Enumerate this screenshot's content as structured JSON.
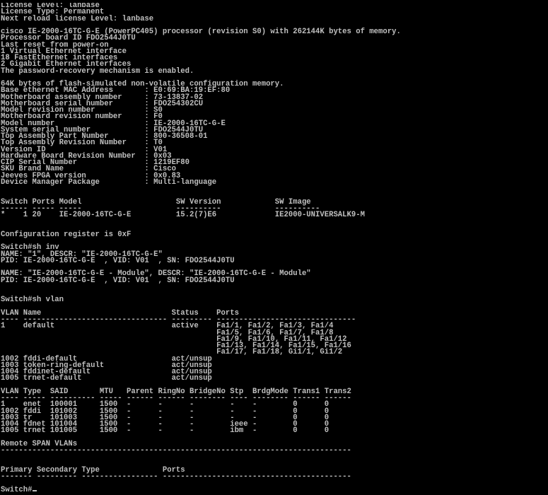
{
  "window": {
    "background_color": "#000000",
    "text_color": "#c0c0c0"
  },
  "terminal": {
    "lines": [
      "License Level: lanbase",
      "License Type: Permanent",
      "Next reload license Level: lanbase",
      "",
      "cisco IE-2000-16TC-G-E (PowerPC405) processor (revision S0) with 262144K bytes of memory.",
      "Processor board ID FDO2544J0TU",
      "Last reset from power-on",
      "1 Virtual Ethernet interface",
      "18 FastEthernet interfaces",
      "2 Gigabit Ethernet interfaces",
      "The password-recovery mechanism is enabled.",
      "",
      "64K bytes of flash-simulated non-volatile configuration memory.",
      "Base ethernet MAC Address       : E0:69:BA:19:EF:80",
      "Motherboard assembly number     : 73-13837-02",
      "Motherboard serial number       : FDO254302CU",
      "Model revision number           : S0",
      "Motherboard revision number     : F0",
      "Model number                    : IE-2000-16TC-G-E",
      "System serial number            : FDO2544J0TU",
      "Top Assembly Part Number        : 800-36508-01",
      "Top Assembly Revision Number    : T0",
      "Version ID                      : V01",
      "Hardware Board Revision Number  : 0x03",
      "CIP Serial Number               : 1219EF80",
      "SKU Brand Name                  : Cisco",
      "Jeeves FPGA version             : 0x0.83",
      "Device Manager Package          : Multi-language",
      "",
      "",
      "Switch Ports Model                     SW Version            SW Image",
      "------ ----- -----                     ----------            ----------",
      "*    1 20    IE-2000-16TC-G-E          15.2(7)E6             IE2000-UNIVERSALK9-M",
      "",
      "",
      "Configuration register is 0xF",
      "",
      "Switch#sh inv",
      "NAME: \"1\", DESCR: \"IE-2000-16TC-G-E\"",
      "PID: IE-2000-16TC-G-E  , VID: V01  , SN: FDO2544J0TU",
      "",
      "NAME: \"IE-2000-16TC-G-E - Module\", DESCR: \"IE-2000-16TC-G-E - Module\"",
      "PID: IE-2000-16TC-G-E  , VID: V01  , SN: FDO2544J0TU",
      "",
      "",
      "Switch#sh vlan",
      "",
      "VLAN Name                             Status    Ports",
      "---- -------------------------------- --------- -------------------------------",
      "1    default                          active    Fa1/1, Fa1/2, Fa1/3, Fa1/4",
      "                                                Fa1/5, Fa1/6, Fa1/7, Fa1/8",
      "                                                Fa1/9, Fa1/10, Fa1/11, Fa1/12",
      "                                                Fa1/13, Fa1/14, Fa1/15, Fa1/16",
      "                                                Fa1/17, Fa1/18, Gi1/1, Gi1/2",
      "1002 fddi-default                     act/unsup",
      "1003 token-ring-default               act/unsup",
      "1004 fddinet-default                  act/unsup",
      "1005 trnet-default                    act/unsup",
      "",
      "VLAN Type  SAID       MTU   Parent RingNo BridgeNo Stp  BrdgMode Trans1 Trans2",
      "---- ----- ---------- ----- ------ ------ -------- ---- -------- ------ ------",
      "1    enet  100001     1500  -      -      -        -    -        0      0",
      "1002 fddi  101002     1500  -      -      -        -    -        0      0",
      "1003 tr    101003     1500  -      -      -        -    -        0      0",
      "1004 fdnet 101004     1500  -      -      -        ieee -        0      0",
      "1005 trnet 101005     1500  -      -      -        ibm  -        0      0",
      "",
      "Remote SPAN VLANs",
      "------------------------------------------------------------------------------",
      "",
      "",
      "Primary Secondary Type              Ports",
      "------- --------- ----------------- ------------------------------------------",
      "",
      "Switch#"
    ]
  }
}
